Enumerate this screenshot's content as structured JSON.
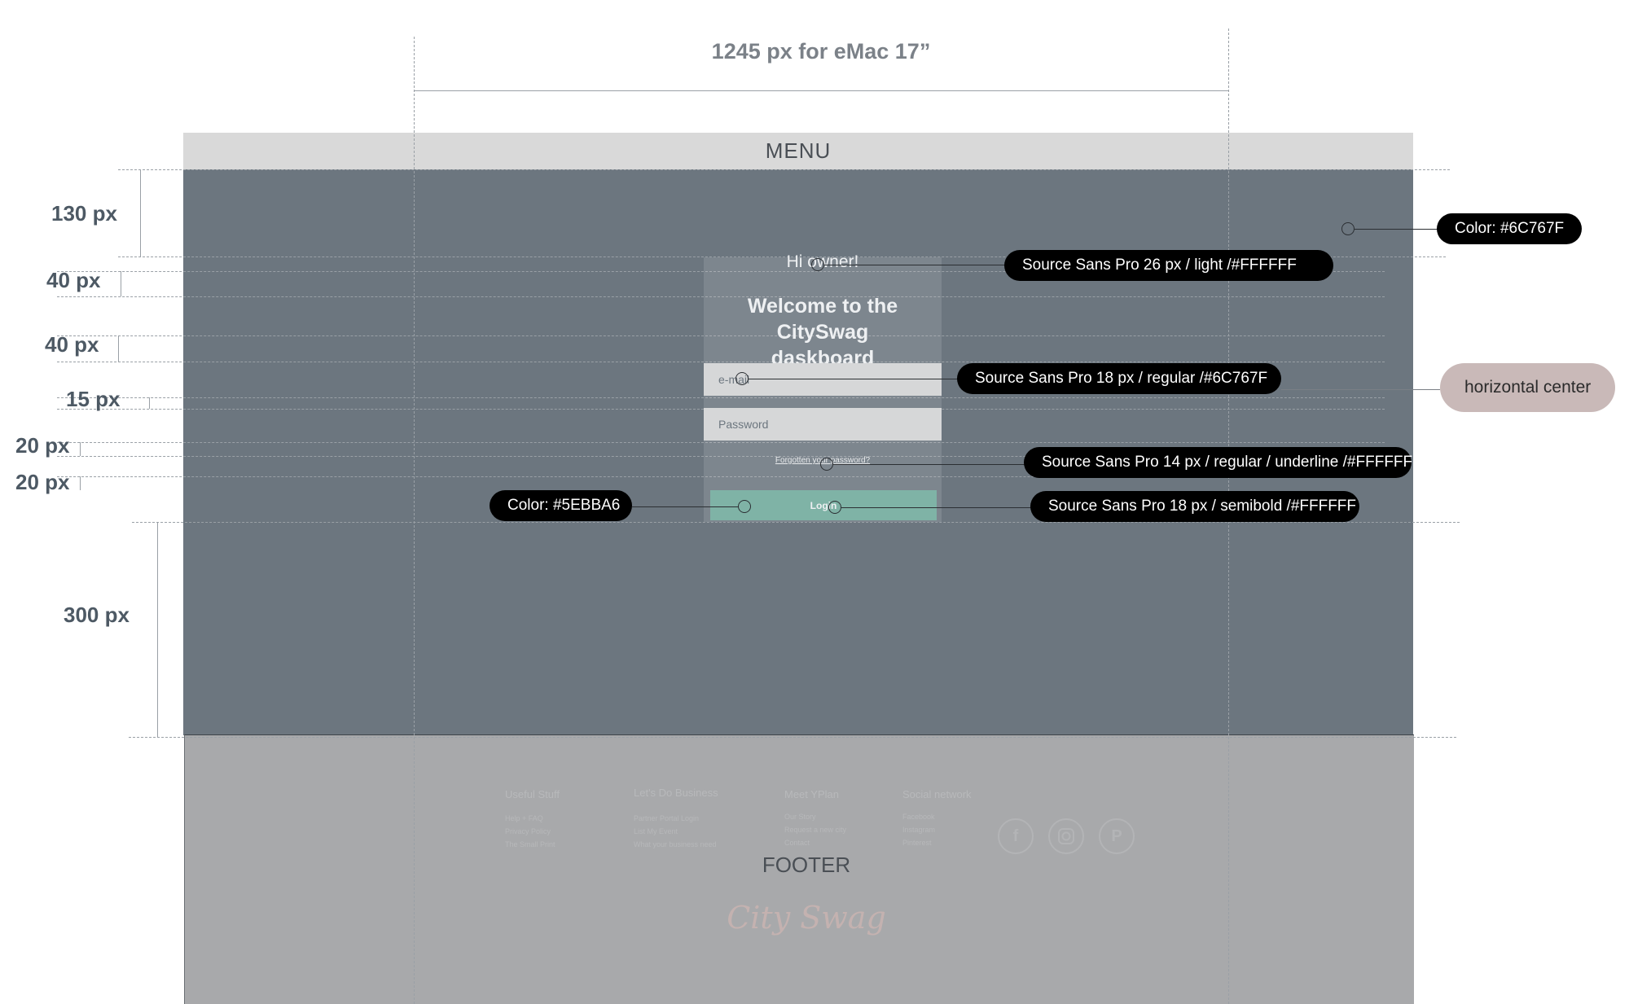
{
  "header": {
    "width_note": "1245 px for eMac 17”"
  },
  "menu": {
    "label": "MENU"
  },
  "measurements": {
    "m1": "130 px",
    "m2": "40 px",
    "m3": "40 px",
    "m4": "15 px",
    "m5": "20 px",
    "m6": "20 px",
    "m7": "300 px"
  },
  "login": {
    "greeting": "Hi owner!",
    "welcome_line1": "Welcome to the CitySwag",
    "welcome_line2": "daskboard",
    "email_placeholder": "e-mail",
    "password_placeholder": "Password",
    "forgot_link": "Forgotten your password?",
    "login_button": "Login"
  },
  "annotations": {
    "bg_color": "Color: #6C767F",
    "greeting_font": "Source Sans Pro 26 px / light /#FFFFFF",
    "field_font": "Source Sans Pro 18 px / regular /#6C767F",
    "align_note": "horizontal center",
    "link_font": "Source Sans Pro 14 px / regular / underline /#FFFFFF",
    "button_color": "Color: #5EBBA6",
    "button_font": "Source Sans Pro 18 px / semibold /#FFFFFF"
  },
  "footer": {
    "label": "FOOTER",
    "columns": [
      {
        "title": "Useful Stuff",
        "links": [
          "Help + FAQ",
          "Privacy Policy",
          "The Small Print"
        ]
      },
      {
        "title": "Let's Do Business",
        "links": [
          "Partner Portal Login",
          "List My Event",
          "What your business need"
        ]
      },
      {
        "title": "Meet YPlan",
        "links": [
          "Our Story",
          "Request a new city",
          "Contact"
        ]
      },
      {
        "title": "Social network",
        "links": [
          "Facebook",
          "Instagram",
          "Pinterest"
        ]
      }
    ],
    "social_icons": [
      "facebook-icon",
      "instagram-icon",
      "pinterest-icon"
    ],
    "logo": "City Swag"
  },
  "colors": {
    "background": "#6C767F",
    "button": "#5EBBA6",
    "menu_bar": "#D9D9D9",
    "footer": "#A8A9AB"
  }
}
